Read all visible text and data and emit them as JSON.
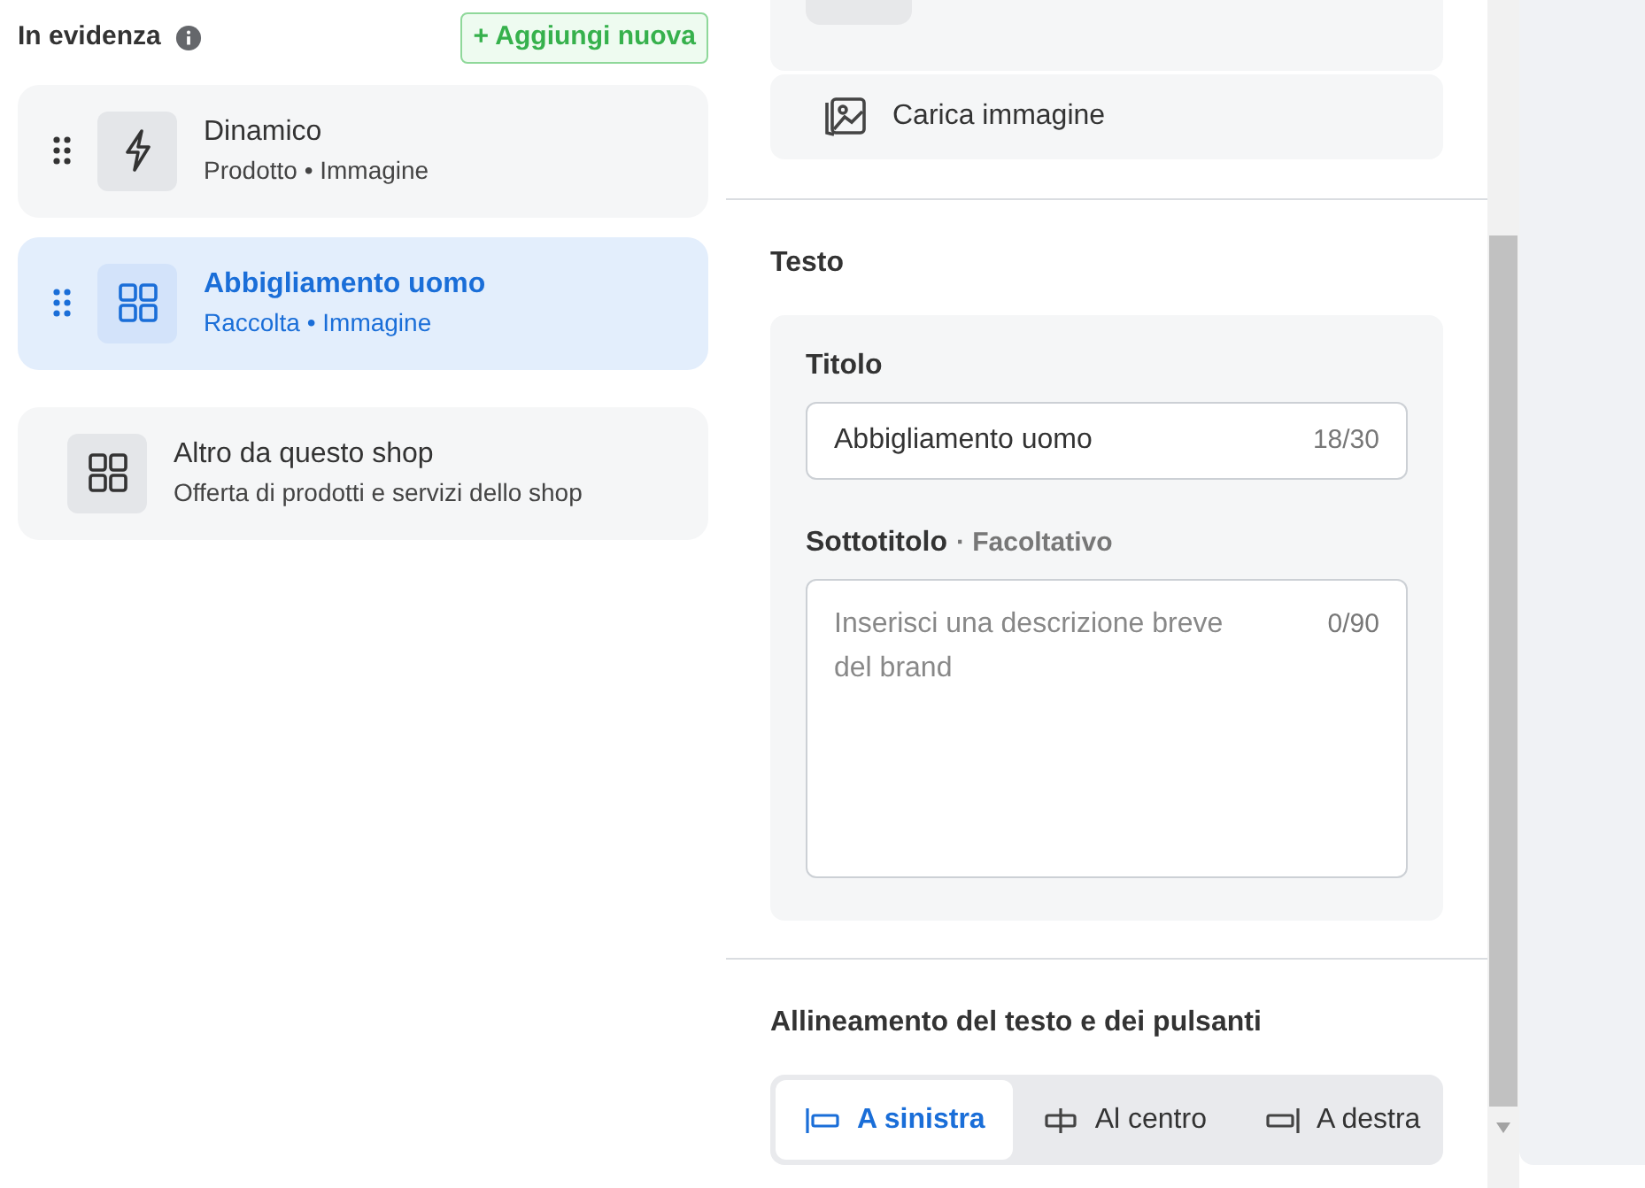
{
  "featured": {
    "title": "In evidenza",
    "add_button": "+ Aggiungi nuova",
    "items": [
      {
        "kind": "dynamic",
        "title": "Dinamico",
        "subtitle": "Prodotto • Immagine",
        "selected": false
      },
      {
        "kind": "collection",
        "title": "Abbigliamento uomo",
        "subtitle": "Raccolta • Immagine",
        "selected": true
      },
      {
        "kind": "shop",
        "title": "Altro da questo shop",
        "subtitle": "Offerta di prodotti e servizi dello shop",
        "selected": false
      }
    ]
  },
  "image": {
    "upload_label": "Carica immagine"
  },
  "text_section": {
    "heading": "Testo",
    "title_field": {
      "label": "Titolo",
      "value": "Abbigliamento uomo",
      "count": "18/30"
    },
    "subtitle_field": {
      "label": "Sottotitolo",
      "optional": "· Facoltativo",
      "placeholder": "Inserisci una descrizione breve del brand",
      "count": "0/90"
    }
  },
  "alignment": {
    "heading": "Allineamento del testo e dei pulsanti",
    "options": [
      {
        "kind": "left",
        "label": "A sinistra",
        "selected": true
      },
      {
        "kind": "center",
        "label": "Al centro",
        "selected": false
      },
      {
        "kind": "right",
        "label": "A destra",
        "selected": false
      }
    ]
  }
}
